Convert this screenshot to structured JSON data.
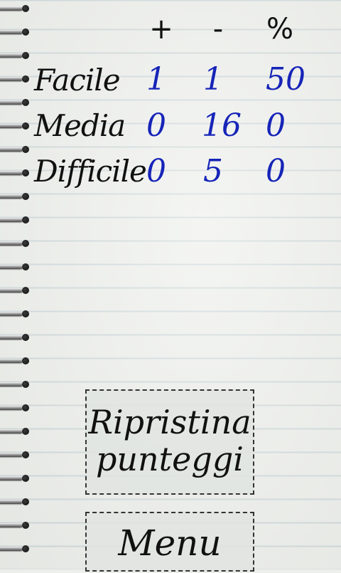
{
  "table": {
    "headers": {
      "plus": "+",
      "minus": "-",
      "percent": "%"
    },
    "rows": [
      {
        "label": "Facile",
        "correct": "1",
        "wrong": "1",
        "percent": "50"
      },
      {
        "label": "Media",
        "correct": "0",
        "wrong": "16",
        "percent": "0"
      },
      {
        "label": "Difficile",
        "correct": "0",
        "wrong": "5",
        "percent": "0"
      }
    ]
  },
  "buttons": {
    "reset_line1": "Ripristina",
    "reset_line2": "punteggi",
    "menu": "Menu"
  },
  "colors": {
    "number_color": "#1624b8",
    "text_color": "#111111"
  }
}
